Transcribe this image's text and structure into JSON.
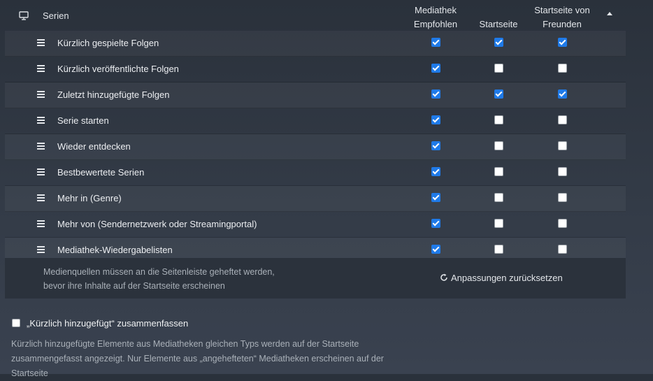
{
  "header": {
    "title": "Serien",
    "columns": [
      "Mediathek\nEmpfohlen",
      "Startseite",
      "Startseite von\nFreunden"
    ]
  },
  "rows": [
    {
      "label": "Kürzlich gespielte Folgen",
      "checks": [
        true,
        true,
        true
      ]
    },
    {
      "label": "Kürzlich veröffentlichte Folgen",
      "checks": [
        true,
        false,
        false
      ]
    },
    {
      "label": "Zuletzt hinzugefügte Folgen",
      "checks": [
        true,
        true,
        true
      ]
    },
    {
      "label": "Serie starten",
      "checks": [
        true,
        false,
        false
      ]
    },
    {
      "label": "Wieder entdecken",
      "checks": [
        true,
        false,
        false
      ]
    },
    {
      "label": "Bestbewertete Serien",
      "checks": [
        true,
        false,
        false
      ]
    },
    {
      "label": "Mehr in (Genre)",
      "checks": [
        true,
        false,
        false
      ]
    },
    {
      "label": "Mehr von (Sendernetzwerk oder Streamingportal)",
      "checks": [
        true,
        false,
        false
      ]
    },
    {
      "label": "Mediathek-Wiedergabelisten",
      "checks": [
        true,
        false,
        false
      ]
    }
  ],
  "footer": {
    "note_line1": "Medienquellen müssen an die Seitenleiste geheftet werden,",
    "note_line2": "bevor ihre Inhalte auf der Startseite erscheinen",
    "reset_label": "Anpassungen zurücksetzen"
  },
  "combine": {
    "label": "„Kürzlich hinzugefügt“ zusammenfassen",
    "checked": false,
    "description": "Kürzlich hinzugefügte Elemente aus Mediatheken gleichen Typs werden auf der Startseite zusammengefasst angezeigt. Nur Elemente aus „angehefteten“ Mediatheken erscheinen auf der Startseite"
  },
  "colors": {
    "checkbox_checked": "#1f7ae8",
    "background": "#2f3640"
  }
}
